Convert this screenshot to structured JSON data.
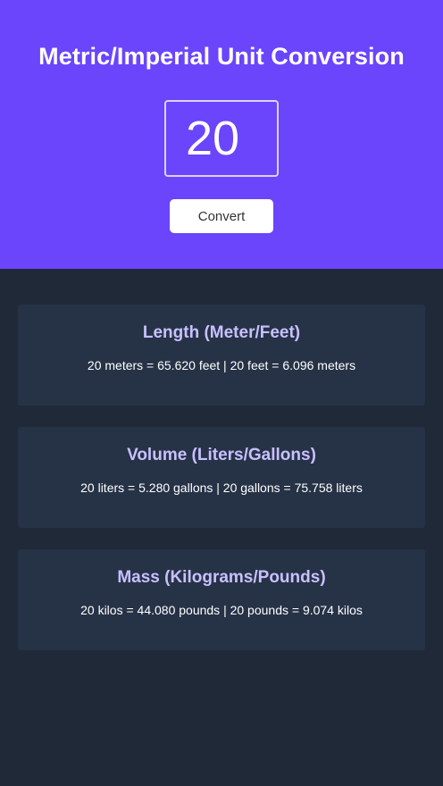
{
  "header": {
    "title": "Metric/Imperial Unit Conversion",
    "input_value": "20",
    "convert_label": "Convert"
  },
  "colors": {
    "header_bg": "#6a45fc",
    "page_bg": "#1f2937",
    "card_bg": "#263246",
    "card_title": "#c9c0ff"
  },
  "cards": [
    {
      "title": "Length (Meter/Feet)",
      "text": "20 meters = 65.620 feet | 20 feet = 6.096 meters"
    },
    {
      "title": "Volume (Liters/Gallons)",
      "text": "20 liters = 5.280 gallons | 20 gallons = 75.758 liters"
    },
    {
      "title": "Mass (Kilograms/Pounds)",
      "text": "20 kilos = 44.080 pounds | 20 pounds = 9.074 kilos"
    }
  ]
}
